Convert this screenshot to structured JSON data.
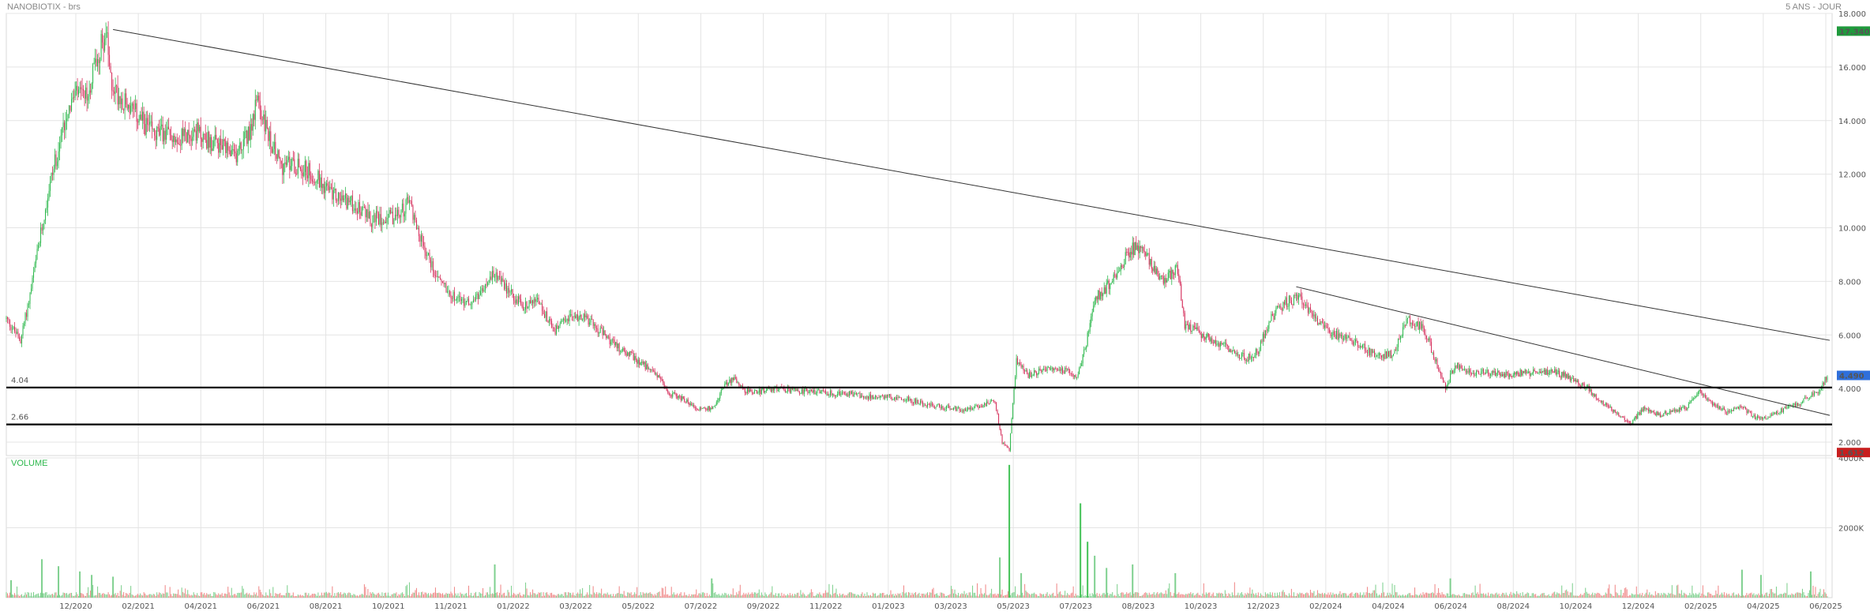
{
  "header": {
    "title": "NANOBIOTIX - brs",
    "period": "5 ANS - JOUR"
  },
  "colors": {
    "up": "#2db84d",
    "down": "#d6335f",
    "grid": "#e4e4e4",
    "last_badge": "#2f6fdb",
    "high_badge": "#1f9a3c",
    "low_badge": "#c81e1e"
  },
  "chart_data": {
    "type": "candlestick",
    "title": "NANOBIOTIX - brs",
    "price_axis": {
      "min": 1.5,
      "max": 18.0,
      "ticks": [
        "2.000",
        "4.000",
        "6.000",
        "8.000",
        "10.000",
        "12.000",
        "14.000",
        "16.000",
        "18.000"
      ]
    },
    "volume_axis": {
      "min": 0,
      "max": 4000,
      "unit": "K",
      "ticks": [
        "2000K",
        "4000K"
      ]
    },
    "date_axis": {
      "labels": [
        "12/2020",
        "02/2021",
        "04/2021",
        "06/2021",
        "08/2021",
        "10/2021",
        "11/2021",
        "01/2022",
        "03/2022",
        "05/2022",
        "07/2022",
        "09/2022",
        "11/2022",
        "01/2023",
        "03/2023",
        "05/2023",
        "07/2023",
        "08/2023",
        "10/2023",
        "12/2023",
        "02/2024",
        "04/2024",
        "06/2024",
        "08/2024",
        "10/2024",
        "12/2024",
        "02/2025",
        "04/2025",
        "06/2025"
      ]
    },
    "price_path": [
      [
        0,
        6.6
      ],
      [
        6,
        6.2
      ],
      [
        12,
        5.8
      ],
      [
        20,
        7.5
      ],
      [
        28,
        9.5
      ],
      [
        36,
        11.5
      ],
      [
        44,
        13
      ],
      [
        52,
        14.5
      ],
      [
        60,
        15
      ],
      [
        68,
        14.8
      ],
      [
        74,
        16
      ],
      [
        80,
        16.8
      ],
      [
        84,
        17.3
      ],
      [
        88,
        15.5
      ],
      [
        94,
        15
      ],
      [
        104,
        14.5
      ],
      [
        114,
        14
      ],
      [
        124,
        13.5
      ],
      [
        134,
        13.5
      ],
      [
        148,
        13.4
      ],
      [
        160,
        13.6
      ],
      [
        172,
        13.2
      ],
      [
        182,
        13.0
      ],
      [
        192,
        12.6
      ],
      [
        204,
        13.5
      ],
      [
        212,
        14.7
      ],
      [
        222,
        13.3
      ],
      [
        232,
        12.3
      ],
      [
        242,
        12.4
      ],
      [
        252,
        12.2
      ],
      [
        264,
        11.8
      ],
      [
        276,
        11.2
      ],
      [
        288,
        11.0
      ],
      [
        298,
        10.7
      ],
      [
        308,
        10.3
      ],
      [
        318,
        10.4
      ],
      [
        330,
        10.4
      ],
      [
        340,
        11
      ],
      [
        350,
        9.5
      ],
      [
        362,
        8.3
      ],
      [
        374,
        7.6
      ],
      [
        386,
        7.2
      ],
      [
        398,
        7.4
      ],
      [
        412,
        8.3
      ],
      [
        424,
        7.6
      ],
      [
        436,
        7.1
      ],
      [
        448,
        7.3
      ],
      [
        462,
        6.1
      ],
      [
        476,
        6.7
      ],
      [
        490,
        6.6
      ],
      [
        502,
        6.1
      ],
      [
        514,
        5.6
      ],
      [
        528,
        5.2
      ],
      [
        540,
        4.8
      ],
      [
        552,
        4.4
      ],
      [
        560,
        3.8
      ],
      [
        572,
        3.6
      ],
      [
        584,
        3.2
      ],
      [
        596,
        3.3
      ],
      [
        606,
        4.1
      ],
      [
        614,
        4.4
      ],
      [
        624,
        3.9
      ],
      [
        636,
        3.9
      ],
      [
        650,
        4.0
      ],
      [
        664,
        3.9
      ],
      [
        680,
        3.9
      ],
      [
        696,
        3.8
      ],
      [
        712,
        3.8
      ],
      [
        728,
        3.7
      ],
      [
        744,
        3.7
      ],
      [
        760,
        3.6
      ],
      [
        776,
        3.4
      ],
      [
        792,
        3.3
      ],
      [
        808,
        3.2
      ],
      [
        824,
        3.4
      ],
      [
        834,
        3.5
      ],
      [
        840,
        2.0
      ],
      [
        846,
        1.7
      ],
      [
        852,
        5.1
      ],
      [
        862,
        4.5
      ],
      [
        876,
        4.7
      ],
      [
        890,
        4.7
      ],
      [
        904,
        4.5
      ],
      [
        910,
        5.5
      ],
      [
        918,
        7.3
      ],
      [
        928,
        7.8
      ],
      [
        938,
        8.4
      ],
      [
        948,
        9.2
      ],
      [
        956,
        9.3
      ],
      [
        966,
        8.7
      ],
      [
        976,
        7.9
      ],
      [
        984,
        8.4
      ],
      [
        988,
        8.5
      ],
      [
        994,
        6.4
      ],
      [
        1006,
        6.1
      ],
      [
        1018,
        5.8
      ],
      [
        1032,
        5.5
      ],
      [
        1046,
        5.1
      ],
      [
        1056,
        5.4
      ],
      [
        1066,
        6.6
      ],
      [
        1078,
        7.2
      ],
      [
        1090,
        7.4
      ],
      [
        1102,
        6.8
      ],
      [
        1114,
        6.1
      ],
      [
        1128,
        5.9
      ],
      [
        1142,
        5.6
      ],
      [
        1156,
        5.2
      ],
      [
        1170,
        5.3
      ],
      [
        1182,
        6.6
      ],
      [
        1196,
        6.2
      ],
      [
        1206,
        5.0
      ],
      [
        1214,
        4.0
      ],
      [
        1222,
        4.9
      ],
      [
        1236,
        4.6
      ],
      [
        1250,
        4.6
      ],
      [
        1264,
        4.5
      ],
      [
        1278,
        4.6
      ],
      [
        1292,
        4.6
      ],
      [
        1306,
        4.6
      ],
      [
        1320,
        4.4
      ],
      [
        1334,
        4.0
      ],
      [
        1348,
        3.4
      ],
      [
        1360,
        3.0
      ],
      [
        1370,
        2.7
      ],
      [
        1382,
        3.3
      ],
      [
        1394,
        3.0
      ],
      [
        1408,
        3.2
      ],
      [
        1418,
        3.3
      ],
      [
        1428,
        3.9
      ],
      [
        1440,
        3.4
      ],
      [
        1452,
        3.1
      ],
      [
        1464,
        3.3
      ],
      [
        1476,
        2.9
      ],
      [
        1486,
        2.9
      ],
      [
        1498,
        3.2
      ],
      [
        1510,
        3.4
      ],
      [
        1522,
        3.7
      ],
      [
        1530,
        4.0
      ],
      [
        1536,
        4.5
      ]
    ],
    "last_value": "4.490",
    "period_high": "17.340",
    "period_low": "1.612",
    "horizontal_levels": [
      {
        "label": "4.04",
        "value": 4.04
      },
      {
        "label": "2.66",
        "value": 2.66
      }
    ],
    "trendlines": [
      {
        "from": [
          90,
          17.4
        ],
        "to": [
          1538,
          5.8
        ]
      },
      {
        "from": [
          1088,
          7.8
        ],
        "to": [
          1538,
          3.0
        ]
      }
    ],
    "volume_label": "VOLUME",
    "volume_spikes": [
      [
        4,
        500
      ],
      [
        30,
        1100
      ],
      [
        44,
        900
      ],
      [
        62,
        750
      ],
      [
        72,
        650
      ],
      [
        90,
        600
      ],
      [
        412,
        950
      ],
      [
        595,
        550
      ],
      [
        838,
        1150
      ],
      [
        846,
        3800
      ],
      [
        856,
        700
      ],
      [
        906,
        2700
      ],
      [
        912,
        1600
      ],
      [
        918,
        1200
      ],
      [
        928,
        850
      ],
      [
        950,
        950
      ],
      [
        986,
        700
      ],
      [
        1218,
        550
      ],
      [
        1464,
        800
      ],
      [
        1480,
        650
      ],
      [
        1522,
        750
      ]
    ]
  }
}
